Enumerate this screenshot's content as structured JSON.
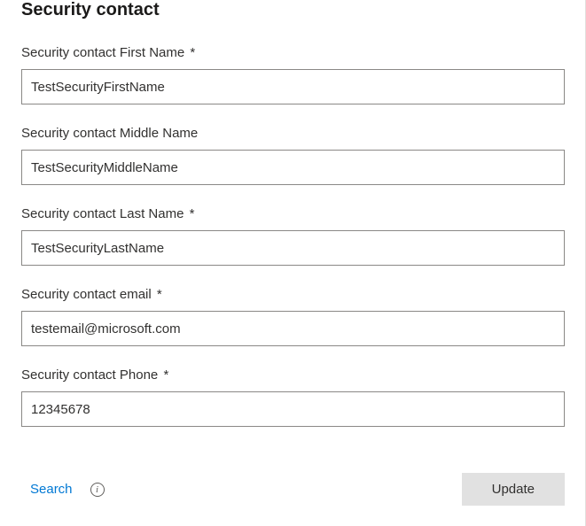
{
  "section": {
    "title": "Security contact"
  },
  "fields": {
    "firstName": {
      "label": "Security contact First Name",
      "required": "*",
      "value": "TestSecurityFirstName"
    },
    "middleName": {
      "label": "Security contact Middle Name",
      "required": "",
      "value": "TestSecurityMiddleName"
    },
    "lastName": {
      "label": "Security contact Last Name",
      "required": "*",
      "value": "TestSecurityLastName"
    },
    "email": {
      "label": "Security contact email",
      "required": "*",
      "value": "testemail@microsoft.com"
    },
    "phone": {
      "label": "Security contact Phone",
      "required": "*",
      "value": "12345678"
    }
  },
  "footer": {
    "searchLabel": "Search",
    "infoGlyph": "i",
    "updateLabel": "Update"
  }
}
